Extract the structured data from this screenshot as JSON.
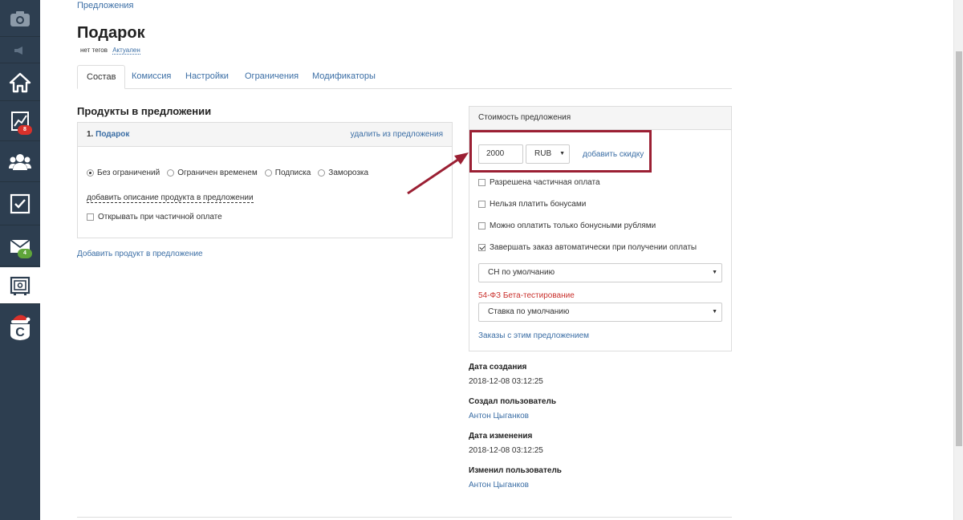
{
  "sidebar": {
    "items": [
      {
        "icon": "camera-icon"
      },
      {
        "icon": "megaphone-icon"
      },
      {
        "icon": "home-icon"
      },
      {
        "icon": "chart-icon",
        "badge": "8"
      },
      {
        "icon": "users-icon"
      },
      {
        "icon": "checkbox-icon"
      },
      {
        "icon": "mail-icon",
        "badge": "4"
      },
      {
        "icon": "safe-icon"
      },
      {
        "icon": "logo-santa-icon"
      }
    ],
    "colors": {
      "bg": "#2d3e50",
      "badge_red": "#d9312b",
      "badge_green": "#5fa53a"
    }
  },
  "breadcrumb": "Предложения",
  "page": {
    "title": "Подарок",
    "tags": "нет тегов",
    "status": "Актуален"
  },
  "tabs": [
    "Состав",
    "Комиссия",
    "Настройки",
    "Ограничения",
    "Модификаторы"
  ],
  "products": {
    "section_title": "Продукты в предложении",
    "item_number": "1.",
    "item_name": "Подарок",
    "remove_label": "удалить из предложения",
    "radio_options": [
      "Без ограничений",
      "Ограничен временем",
      "Подписка",
      "Заморозка"
    ],
    "selected_radio": "Без ограничений",
    "add_description": "добавить описание продукта в предложении",
    "open_partial": "Открывать при частичной оплате",
    "add_product": "Добавить продукт в предложение"
  },
  "price": {
    "header": "Стоимость предложения",
    "amount": "2000",
    "currency": "RUB",
    "add_discount": "добавить скидку",
    "options": [
      {
        "label": "Разрешена частичная оплата",
        "checked": false
      },
      {
        "label": "Нельзя платить бонусами",
        "checked": false
      },
      {
        "label": "Можно оплатить только бонусными рублями",
        "checked": false
      },
      {
        "label": "Завершать заказ автоматически при получении оплаты",
        "checked": true
      }
    ],
    "tax_system": "СН по умолчанию",
    "beta_label": "54-ФЗ Бета-тестирование",
    "vat_rate": "Ставка по умолчанию",
    "orders_link": "Заказы с этим предложением"
  },
  "meta": {
    "created_label": "Дата создания",
    "created_value": "2018-12-08 03:12:25",
    "creator_label": "Создал пользователь",
    "creator_value": "Антон Цыганков",
    "modified_label": "Дата изменения",
    "modified_value": "2018-12-08 03:12:25",
    "modifier_label": "Изменил пользователь",
    "modifier_value": "Антон Цыганков"
  },
  "colors": {
    "link": "#3b6ea5",
    "highlight": "#9b1f33",
    "beta": "#c9302c"
  }
}
